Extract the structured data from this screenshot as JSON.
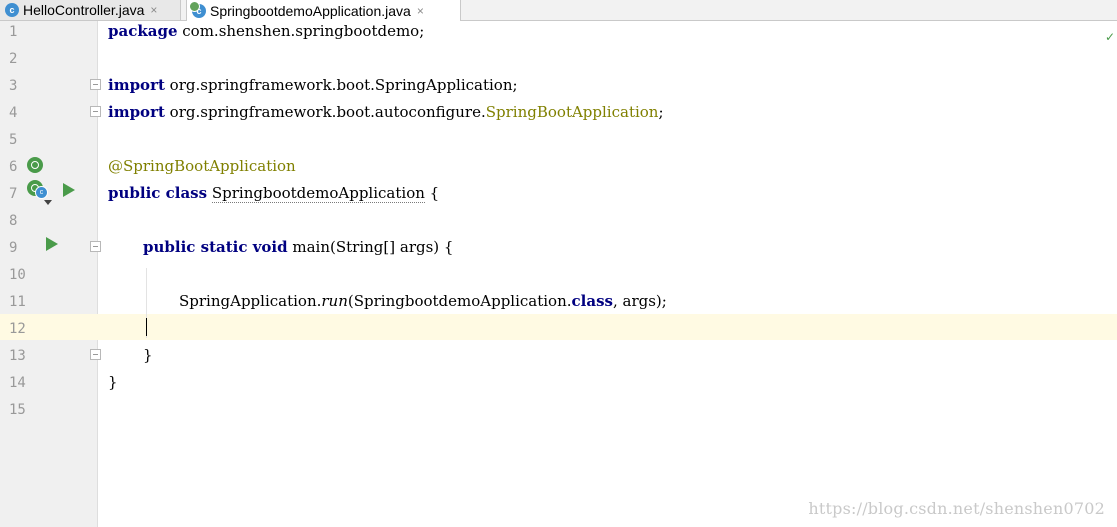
{
  "tabs": [
    {
      "label": "HelloController.java",
      "icon": "class-icon",
      "close": "×"
    },
    {
      "label": "SpringbootdemoApplication.java",
      "icon": "spring-boot-class-icon",
      "close": "×",
      "active": true
    }
  ],
  "line_numbers": [
    "1",
    "2",
    "3",
    "4",
    "5",
    "6",
    "7",
    "8",
    "9",
    "10",
    "11",
    "12",
    "13",
    "14",
    "15"
  ],
  "code": {
    "l1_kw": "package",
    "l1_rest": " com.shenshen.springbootdemo;",
    "l3_kw": "import",
    "l3_rest": " org.springframework.boot.SpringApplication;",
    "l4_kw": "import",
    "l4_rest": " org.springframework.boot.autoconfigure.",
    "l4_ann": "SpringBootApplication",
    "l4_end": ";",
    "l6_ann": "@SpringBootApplication",
    "l7_kw": "public class",
    "l7_sp": " ",
    "l7_name": "SpringbootdemoApplication",
    "l7_rest": " {",
    "l9_kw": "public static void",
    "l9_rest": " main(String[] args) {",
    "l11_a": "SpringApplication.",
    "l11_b": "run",
    "l11_c": "(SpringbootdemoApplication.",
    "l11_kw": "class",
    "l11_d": ", args);",
    "l13": "}",
    "l14": "}"
  },
  "gutter_icons": {
    "line6": "spring-bean-icon",
    "line7": "spring-class-icon",
    "line7_run": "run-icon",
    "line9_run": "run-icon"
  },
  "watermark": "https://blog.csdn.net/shenshen0702",
  "colors": {
    "keyword": "#000080",
    "annotation": "#808000",
    "line_number": "#999999",
    "caret_row": "#fffae3",
    "run_green": "#4a9b4a"
  }
}
